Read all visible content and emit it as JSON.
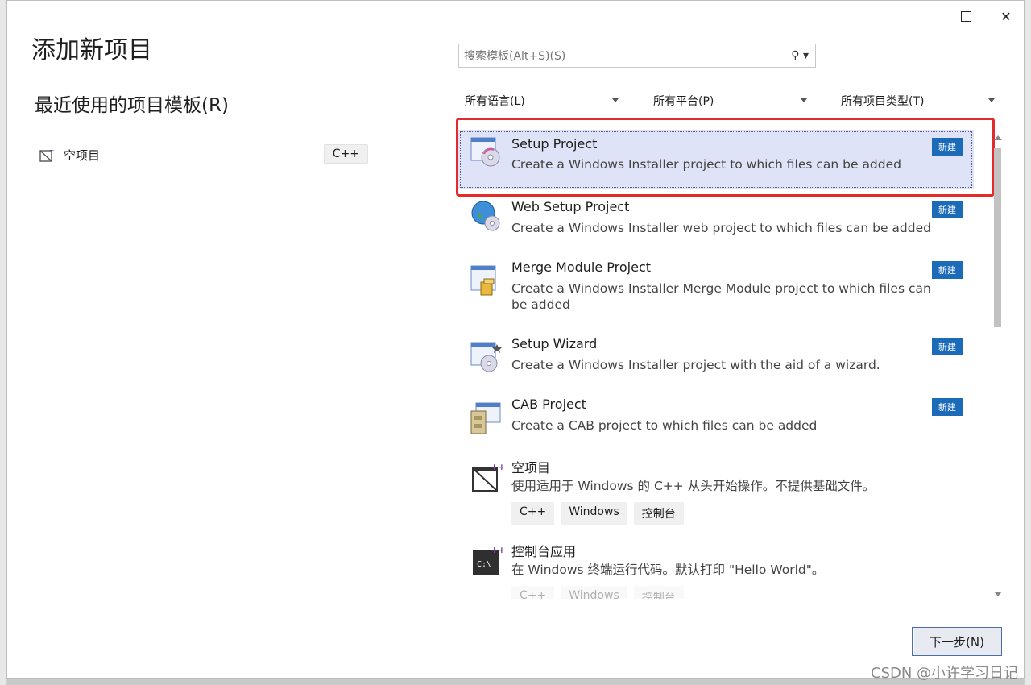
{
  "dialog": {
    "title": "添加新项目",
    "recent_heading": "最近使用的项目模板(R)",
    "recent_items": [
      {
        "label": "空项目",
        "tag": "C++",
        "icon": "empty-project-icon"
      }
    ]
  },
  "search": {
    "placeholder": "搜索模板(Alt+S)(S)",
    "icon": "search-icon"
  },
  "filters": {
    "language": "所有语言(L)",
    "platform": "所有平台(P)",
    "project_type": "所有项目类型(T)"
  },
  "templates": [
    {
      "name": "Setup Project",
      "desc": "Create a Windows Installer project to which files can be added",
      "badge": "新建",
      "icon": "setup-project-icon",
      "selected": true
    },
    {
      "name": "Web Setup Project",
      "desc": "Create a Windows Installer web project to which files can be added",
      "badge": "新建",
      "icon": "web-setup-project-icon"
    },
    {
      "name": "Merge Module Project",
      "desc": "Create a Windows Installer Merge Module project to which files can be added",
      "badge": "新建",
      "icon": "merge-module-icon"
    },
    {
      "name": "Setup Wizard",
      "desc": "Create a Windows Installer project with the aid of a wizard.",
      "badge": "新建",
      "icon": "setup-wizard-icon"
    },
    {
      "name": "CAB Project",
      "desc": "Create a CAB project to which files can be added",
      "badge": "新建",
      "icon": "cab-project-icon"
    },
    {
      "name": "空项目",
      "desc": "使用适用于 Windows 的 C++ 从头开始操作。不提供基础文件。",
      "tags": [
        "C++",
        "Windows",
        "控制台"
      ],
      "icon": "empty-cpp-project-icon"
    },
    {
      "name": "控制台应用",
      "desc": "在 Windows 终端运行代码。默认打印 \"Hello World\"。",
      "tags": [
        "C++",
        "Windows",
        "控制台"
      ],
      "icon": "console-app-icon"
    }
  ],
  "buttons": {
    "next": "下一步(N)"
  },
  "watermark": "CSDN @小许学习日记"
}
